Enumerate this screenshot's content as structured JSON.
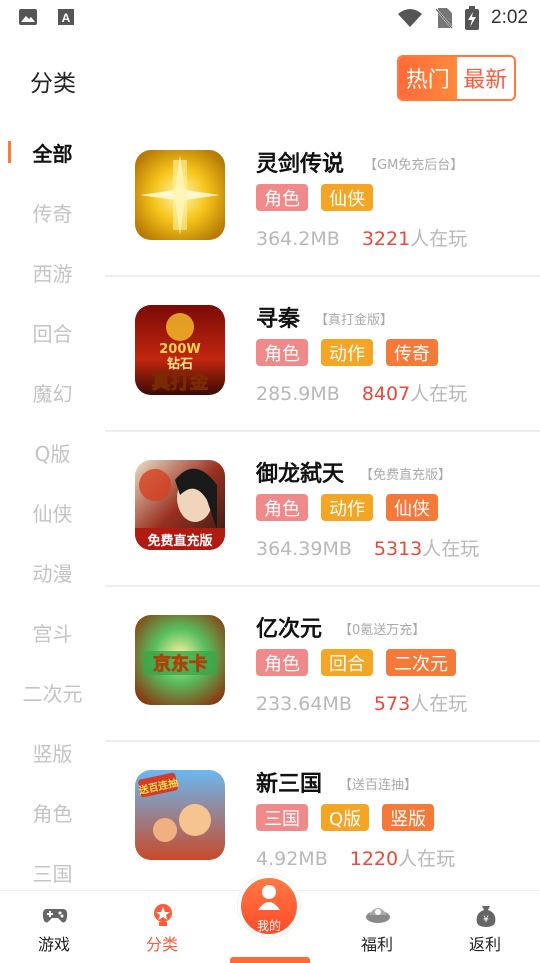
{
  "status_bar": {
    "time": "2:02",
    "icons": [
      "image-icon",
      "text-a-icon",
      "wifi-icon",
      "no-sim-icon",
      "battery-charging-icon"
    ]
  },
  "header": {
    "title": "分类",
    "sort_tabs": [
      {
        "label": "热门",
        "active": true
      },
      {
        "label": "最新",
        "active": false
      }
    ]
  },
  "sidebar": {
    "items": [
      {
        "label": "全部",
        "active": true
      },
      {
        "label": "传奇"
      },
      {
        "label": "西游"
      },
      {
        "label": "回合"
      },
      {
        "label": "魔幻"
      },
      {
        "label": "Q版"
      },
      {
        "label": "仙侠"
      },
      {
        "label": "动漫"
      },
      {
        "label": "宫斗"
      },
      {
        "label": "二次元"
      },
      {
        "label": "竖版"
      },
      {
        "label": "角色"
      },
      {
        "label": "三国"
      }
    ]
  },
  "games": [
    {
      "name": "灵剑传说",
      "tag_note": "【GM免充后台】",
      "tags": [
        "角色",
        "仙侠"
      ],
      "size": "364.2MB",
      "players": "3221",
      "players_suffix": "人在玩"
    },
    {
      "name": "寻秦",
      "tag_note": "【真打金版】",
      "tags": [
        "角色",
        "动作",
        "传奇"
      ],
      "size": "285.9MB",
      "players": "8407",
      "players_suffix": "人在玩",
      "icon_text": [
        "200W",
        "钻石",
        "真打金"
      ]
    },
    {
      "name": "御龙弑天",
      "tag_note": "【免费直充版】",
      "tags": [
        "角色",
        "动作",
        "仙侠"
      ],
      "size": "364.39MB",
      "players": "5313",
      "players_suffix": "人在玩",
      "icon_text": [
        "免费直充版"
      ]
    },
    {
      "name": "亿次元",
      "tag_note": "【0氪送万充】",
      "tags": [
        "角色",
        "回合",
        "二次元"
      ],
      "size": "233.64MB",
      "players": "573",
      "players_suffix": "人在玩",
      "icon_text": [
        "京东卡"
      ]
    },
    {
      "name": "新三国",
      "tag_note": "【送百连抽】",
      "tags": [
        "三国",
        "Q版",
        "竖版"
      ],
      "size": "4.92MB",
      "players": "1220",
      "players_suffix": "人在玩",
      "icon_text": [
        "送百连抽"
      ]
    }
  ],
  "tag_colors": {
    "角色": "#f08a8a",
    "仙侠": "#f5a524",
    "动作": "#f5a524",
    "传奇": "#f57a3a",
    "回合": "#f5a524",
    "二次元": "#f57a3a",
    "三国": "#f08a8a",
    "Q版": "#f5a524",
    "竖版": "#f57a3a"
  },
  "bottom_nav": {
    "items": [
      {
        "label": "游戏",
        "icon": "gamepad-icon"
      },
      {
        "label": "分类",
        "icon": "category-icon",
        "active": true
      },
      {
        "label": "我的",
        "icon": "user-icon"
      },
      {
        "label": "福利",
        "icon": "gift-icon"
      },
      {
        "label": "返利",
        "icon": "money-bag-icon"
      }
    ]
  }
}
